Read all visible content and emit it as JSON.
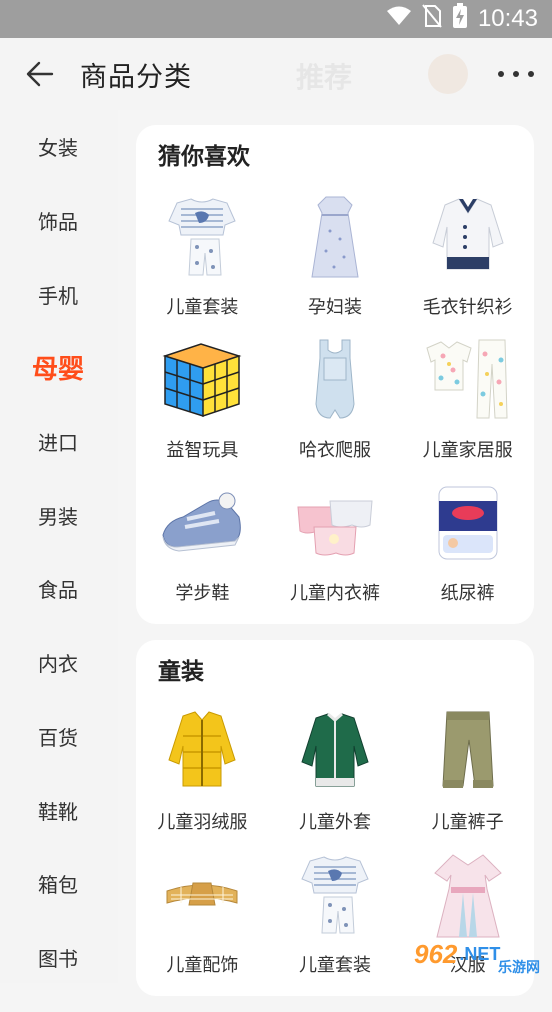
{
  "status_bar": {
    "time": "10:43",
    "icons": [
      "wifi-icon",
      "no-sim-icon",
      "battery-charging-icon"
    ]
  },
  "header": {
    "title": "商品分类",
    "ghost_tab": "推荐",
    "back_icon": "arrow-left-icon",
    "more_icon": "more-dots-icon"
  },
  "sidebar": {
    "items": [
      {
        "label": "女装"
      },
      {
        "label": "饰品"
      },
      {
        "label": "手机"
      },
      {
        "label": "母婴",
        "active": true
      },
      {
        "label": "进口"
      },
      {
        "label": "男装"
      },
      {
        "label": "食品"
      },
      {
        "label": "内衣"
      },
      {
        "label": "百货"
      },
      {
        "label": "鞋靴"
      },
      {
        "label": "箱包"
      },
      {
        "label": "图书"
      }
    ],
    "active_color": "#ff4d1a"
  },
  "sections": [
    {
      "title": "猜你喜欢",
      "items": [
        {
          "label": "儿童套装",
          "icon": "kids-set-icon"
        },
        {
          "label": "孕妇装",
          "icon": "maternity-dress-icon"
        },
        {
          "label": "毛衣针织衫",
          "icon": "kids-cardigan-icon"
        },
        {
          "label": "益智玩具",
          "icon": "rubiks-cube-icon"
        },
        {
          "label": "哈衣爬服",
          "icon": "baby-romper-icon"
        },
        {
          "label": "儿童家居服",
          "icon": "kids-pajamas-icon"
        },
        {
          "label": "学步鞋",
          "icon": "toddler-shoe-icon"
        },
        {
          "label": "儿童内衣裤",
          "icon": "kids-underwear-icon"
        },
        {
          "label": "纸尿裤",
          "icon": "diaper-pack-icon"
        }
      ]
    },
    {
      "title": "童装",
      "items": [
        {
          "label": "儿童羽绒服",
          "icon": "down-jacket-icon"
        },
        {
          "label": "儿童外套",
          "icon": "kids-jacket-icon"
        },
        {
          "label": "儿童裤子",
          "icon": "kids-pants-icon"
        },
        {
          "label": "儿童配饰",
          "icon": "headband-icon"
        },
        {
          "label": "儿童套装",
          "icon": "kids-set-icon"
        },
        {
          "label": "汉服",
          "icon": "hanfu-dress-icon"
        }
      ]
    }
  ],
  "watermark": {
    "number": "962",
    "net": ".NET",
    "text": "乐游网"
  }
}
